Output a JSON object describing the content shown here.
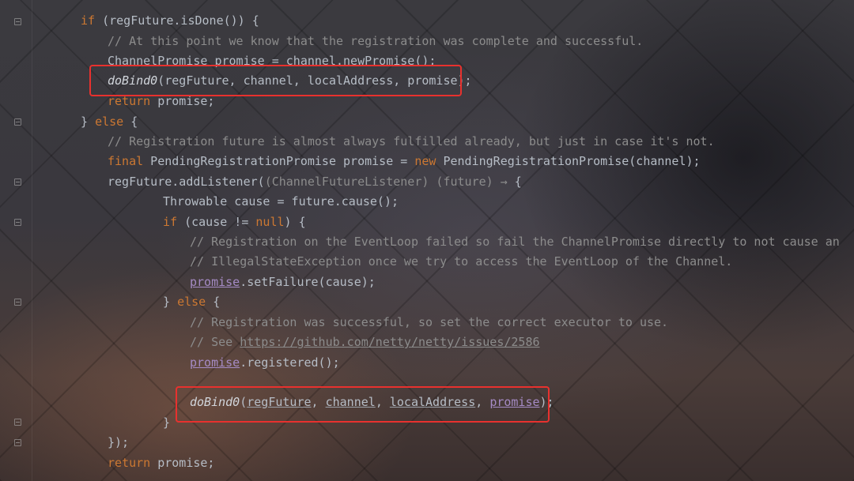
{
  "editor": {
    "lines": {
      "l1": {
        "kw": "if",
        "rest": " (regFuture.isDone()) {"
      },
      "l2": {
        "comment": "// At this point we know that the registration was complete and successful."
      },
      "l3": {
        "text": "ChannelPromise promise = channel.newPromise();"
      },
      "l4": {
        "method": "doBind0",
        "args": "(regFuture, channel, localAddress, promise);"
      },
      "l5": {
        "kw": "return",
        "rest": " promise;"
      },
      "l6": {
        "pre": "} ",
        "kw": "else",
        "rest": " {"
      },
      "l7": {
        "comment": "// Registration future is almost always fulfilled already, but just in case it's not."
      },
      "l8": {
        "kw": "final",
        "mid": " PendingRegistrationPromise promise = ",
        "kw2": "new",
        "rest": " PendingRegistrationPromise(channel);"
      },
      "l9": {
        "pre": "regFuture.addListener(",
        "cast": "(ChannelFutureListener) (future) →",
        "rest": " {"
      },
      "l10": {
        "text": "Throwable cause = future.cause();"
      },
      "l11": {
        "kw": "if",
        "mid": " (cause != ",
        "kw2": "null",
        "rest": ") {"
      },
      "l12": {
        "comment": "// Registration on the EventLoop failed so fail the ChannelPromise directly to not cause an"
      },
      "l13": {
        "comment": "// IllegalStateException once we try to access the EventLoop of the Channel."
      },
      "l14": {
        "var": "promise",
        "rest": ".setFailure(cause);"
      },
      "l15": {
        "pre": "} ",
        "kw": "else",
        "rest": " {"
      },
      "l16": {
        "comment": "// Registration was successful, so set the correct executor to use."
      },
      "l17": {
        "comment": "// See ",
        "link": "https://github.com/netty/netty/issues/2586"
      },
      "l18": {
        "var": "promise",
        "rest": ".registered();"
      },
      "l19": {
        "method": "doBind0",
        "a1": "regFuture",
        "a2": "channel",
        "a3": "localAddress",
        "a4": "promise",
        "comma": ", ",
        "open": "(",
        "close": ");"
      },
      "l20": {
        "text": "}"
      },
      "l21": {
        "text": "});"
      },
      "l22": {
        "kw": "return",
        "rest": " promise;"
      }
    }
  },
  "colors": {
    "highlight_box": "#e8312e",
    "keyword": "#cc7832",
    "comment": "#8c8c8c",
    "field": "#a58bc5"
  }
}
